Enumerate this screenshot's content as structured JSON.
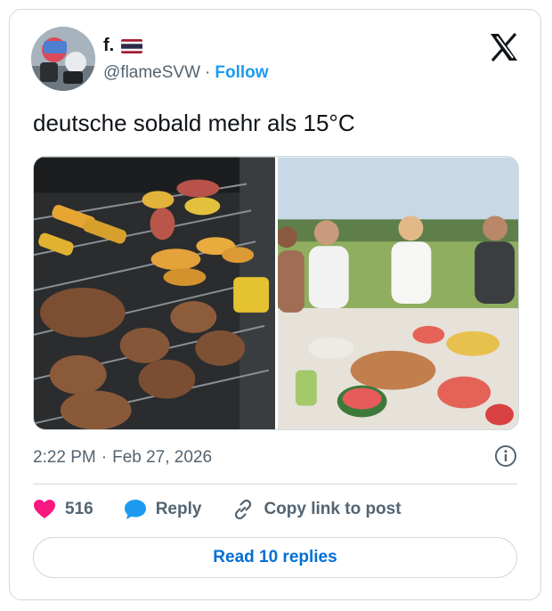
{
  "author": {
    "display_name": "f.",
    "handle": "@flameSVW",
    "separator": "·",
    "follow_label": "Follow"
  },
  "tweet": {
    "text": "deutsche sobald mehr als 15°C",
    "images": [
      {
        "name": "grill-photo"
      },
      {
        "name": "picnic-photo"
      }
    ]
  },
  "meta": {
    "time": "2:22 PM",
    "separator": "·",
    "date": "Feb 27, 2026"
  },
  "actions": {
    "like_count": "516",
    "reply_label": "Reply",
    "copy_link_label": "Copy link to post"
  },
  "read_replies_label": "Read 10 replies",
  "colors": {
    "accent": "#1d9bf0",
    "like": "#f91880",
    "muted": "#536471",
    "border": "#cfd9de"
  },
  "icons": [
    "x-logo-icon",
    "thailand-flag-icon",
    "info-icon",
    "heart-icon",
    "reply-bubble-icon",
    "link-icon"
  ]
}
